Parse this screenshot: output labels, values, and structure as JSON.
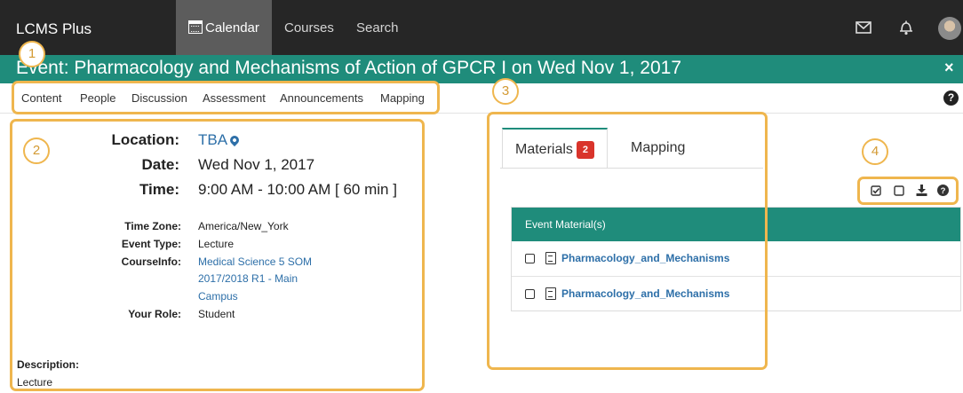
{
  "topbar": {
    "brand": "LCMS Plus",
    "tabs": [
      {
        "label": "Calendar",
        "active": true
      },
      {
        "label": "Courses",
        "active": false
      },
      {
        "label": "Search",
        "active": false
      }
    ],
    "icons": [
      "mail-icon",
      "bell-icon",
      "user-avatar"
    ]
  },
  "event": {
    "title": "Event: Pharmacology and Mechanisms of Action of GPCR I on Wed Nov 1, 2017",
    "close_symbol": "×"
  },
  "subnav": {
    "items": [
      "Content",
      "People",
      "Discussion",
      "Assessment",
      "Announcements",
      "Mapping"
    ],
    "help_symbol": "?"
  },
  "details": {
    "location_label": "Location:",
    "location_value": "TBA",
    "date_label": "Date:",
    "date_value": "Wed Nov 1, 2017",
    "time_label": "Time:",
    "time_value": "9:00 AM - 10:00 AM [ 60 min ]",
    "timezone_label": "Time Zone:",
    "timezone_value": "America/New_York",
    "event_type_label": "Event Type:",
    "event_type_value": "Lecture",
    "courseinfo_label": "CourseInfo:",
    "courseinfo_lines": [
      "Medical Science 5 SOM",
      "2017/2018 R1 - Main",
      "Campus"
    ],
    "role_label": "Your Role:",
    "role_value": "Student",
    "description_label": "Description:",
    "description_value": "Lecture"
  },
  "materials": {
    "tabs": [
      {
        "label": "Materials",
        "badge": "2",
        "active": true
      },
      {
        "label": "Mapping",
        "active": false
      }
    ],
    "table_header": "Event Material(s)",
    "rows": [
      {
        "name": "Pharmacology_and_Mechanisms",
        "icon": "word-file-icon"
      },
      {
        "name": "Pharmacology_and_Mechanisms",
        "icon": "pdf-file-icon"
      }
    ],
    "tools": [
      "select-all-icon",
      "deselect-icon",
      "download-icon",
      "help-icon"
    ]
  },
  "callouts": [
    "1",
    "2",
    "3",
    "4"
  ],
  "colors": {
    "topbar": "#262626",
    "teal": "#1f8c7b",
    "highlight": "#efb64e",
    "link": "#2d6fa8",
    "badge": "#d9342b"
  }
}
